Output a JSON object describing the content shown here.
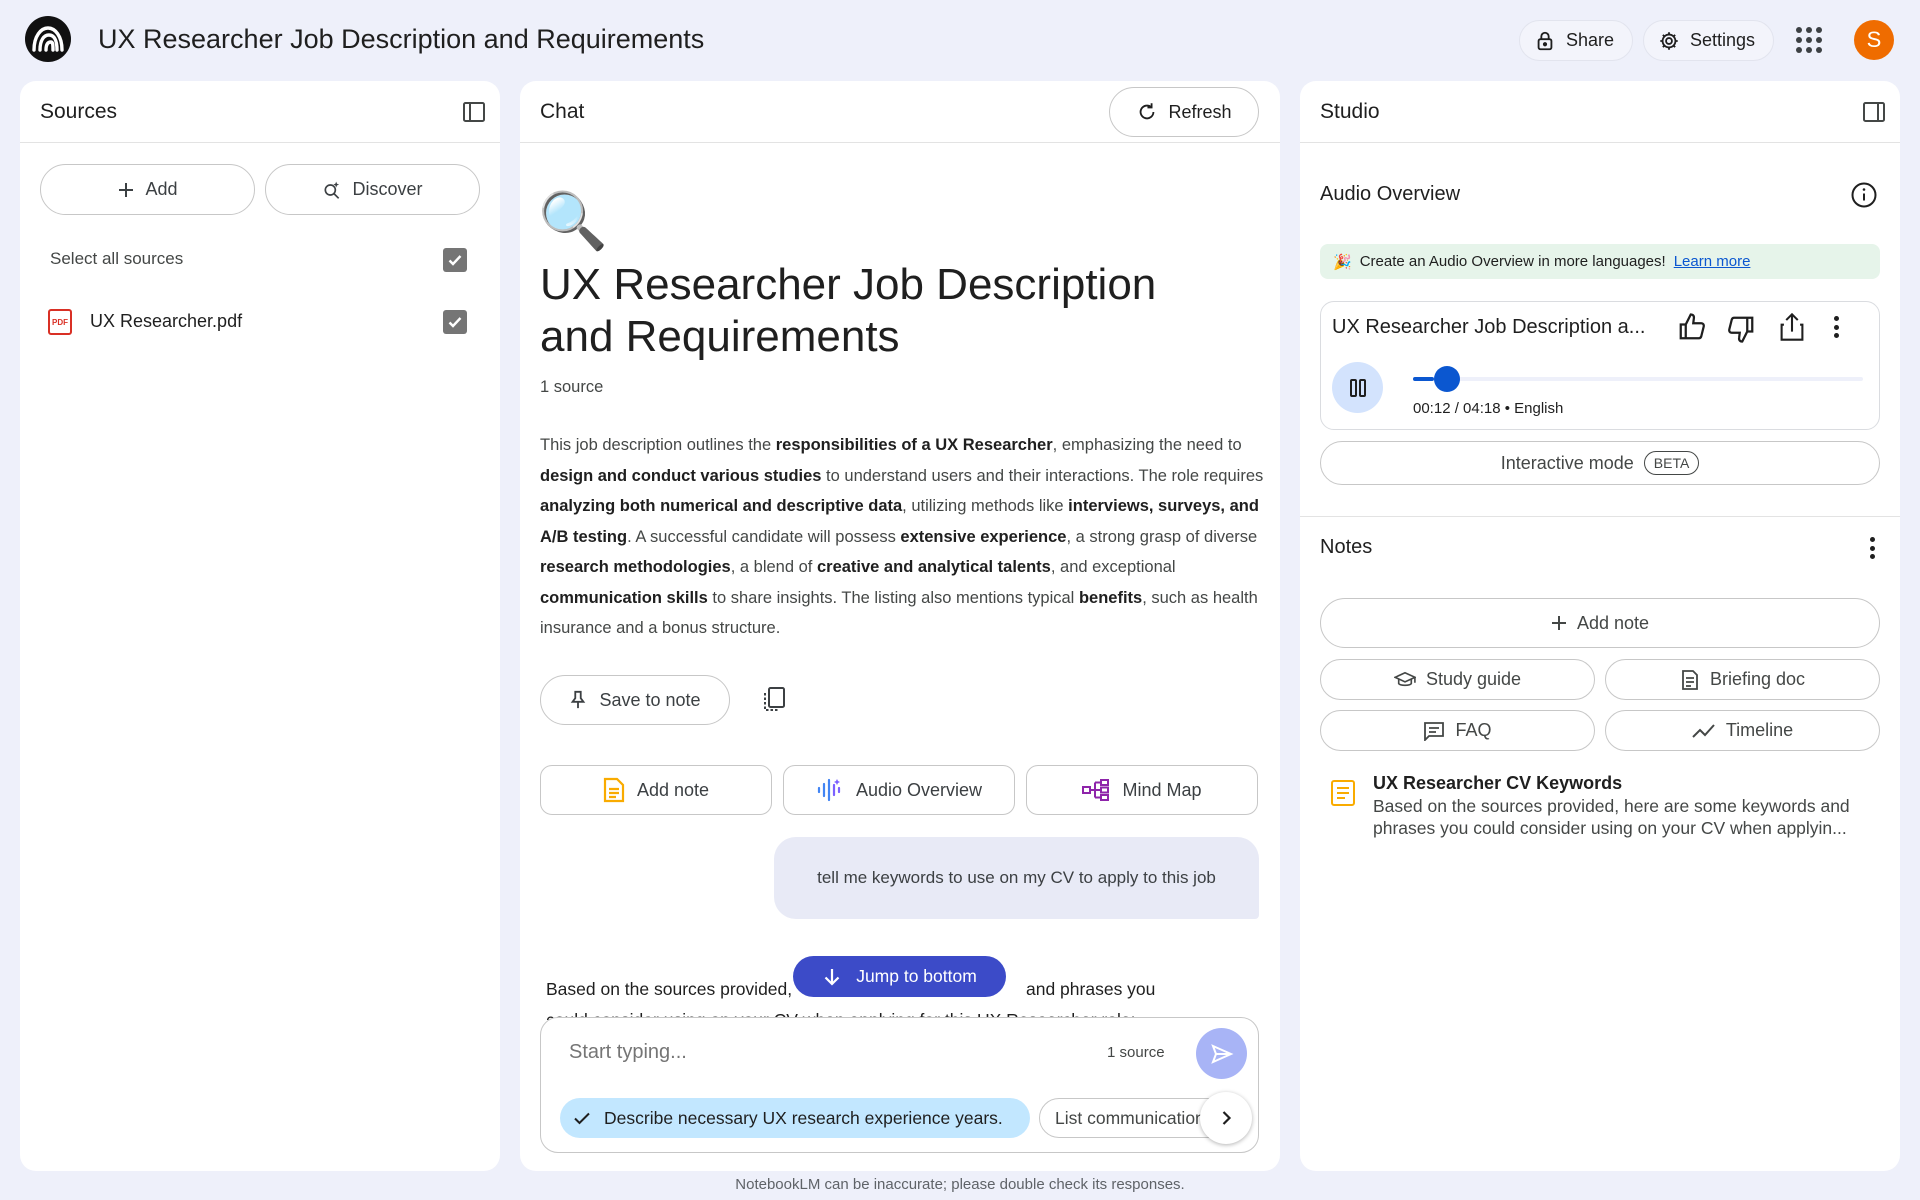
{
  "header": {
    "title": "UX Researcher Job Description and Requirements",
    "share_label": "Share",
    "settings_label": "Settings",
    "avatar_initial": "S"
  },
  "sources": {
    "title": "Sources",
    "add_label": "Add",
    "discover_label": "Discover",
    "select_all_label": "Select all sources",
    "items": [
      {
        "name": "UX Researcher.pdf",
        "type_badge": "PDF",
        "checked": true
      }
    ]
  },
  "chat": {
    "title": "Chat",
    "refresh_label": "Refresh",
    "emoji": "🔍",
    "heading": "UX Researcher Job Description and Requirements",
    "source_count": "1 source",
    "summary_parts": [
      {
        "t": "This job description outlines the ",
        "b": false
      },
      {
        "t": "responsibilities of a UX Researcher",
        "b": true
      },
      {
        "t": ", emphasizing the need to ",
        "b": false
      },
      {
        "t": "design and conduct various studies",
        "b": true
      },
      {
        "t": " to understand users and their interactions. The role requires ",
        "b": false
      },
      {
        "t": "analyzing both numerical and descriptive data",
        "b": true
      },
      {
        "t": ", utilizing methods like ",
        "b": false
      },
      {
        "t": "interviews, surveys, and A/B testing",
        "b": true
      },
      {
        "t": ". A successful candidate will possess ",
        "b": false
      },
      {
        "t": "extensive experience",
        "b": true
      },
      {
        "t": ", a strong grasp of diverse ",
        "b": false
      },
      {
        "t": "research methodologies",
        "b": true
      },
      {
        "t": ", a blend of ",
        "b": false
      },
      {
        "t": "creative and analytical talents",
        "b": true
      },
      {
        "t": ", and exceptional ",
        "b": false
      },
      {
        "t": "communication skills",
        "b": true
      },
      {
        "t": " to share insights. The listing also mentions typical ",
        "b": false
      },
      {
        "t": "benefits",
        "b": true
      },
      {
        "t": ", such as health insurance and a bonus structure.",
        "b": false
      }
    ],
    "save_to_note_label": "Save to note",
    "add_note_label": "Add note",
    "audio_overview_label": "Audio Overview",
    "mind_map_label": "Mind Map",
    "user_message": "tell me keywords to use on my CV to apply to this job",
    "response_line_1_left": "Based on the sources provided,",
    "response_line_1_right": "and phrases you",
    "response_line_2": "could consider using on your CV when applying for this UX Researcher role:",
    "jump_to_bottom_label": "Jump to bottom",
    "input_placeholder": "Start typing...",
    "input_source_count": "1 source",
    "suggestions": [
      "Describe necessary UX research experience years.",
      "List communication skills needed for the role."
    ],
    "disclaimer": "NotebookLM can be inaccurate; please double check its responses."
  },
  "studio": {
    "title": "Studio",
    "audio_overview_title": "Audio Overview",
    "banner_emoji": "🎉",
    "banner_text": "Create an Audio Overview in more languages!",
    "banner_link": "Learn more",
    "player_title": "UX Researcher Job Description a...",
    "player_time": "00:12 / 04:18 • English",
    "player_progress": 0.046,
    "interactive_label": "Interactive mode",
    "beta_label": "BETA",
    "notes_title": "Notes",
    "add_note_label": "Add note",
    "study_guide_label": "Study guide",
    "briefing_doc_label": "Briefing doc",
    "faq_label": "FAQ",
    "timeline_label": "Timeline",
    "note_title": "UX Researcher CV Keywords",
    "note_preview": "Based on the sources provided, here are some keywords and phrases you could consider using on your CV when applyin..."
  },
  "colors": {
    "background": "#eef0fa",
    "accent": "#0b57d0",
    "jump_button": "#3c4bc8",
    "avatar": "#ef6c00",
    "chip_selected": "#c2e7ff",
    "banner": "#e6f4ea"
  }
}
